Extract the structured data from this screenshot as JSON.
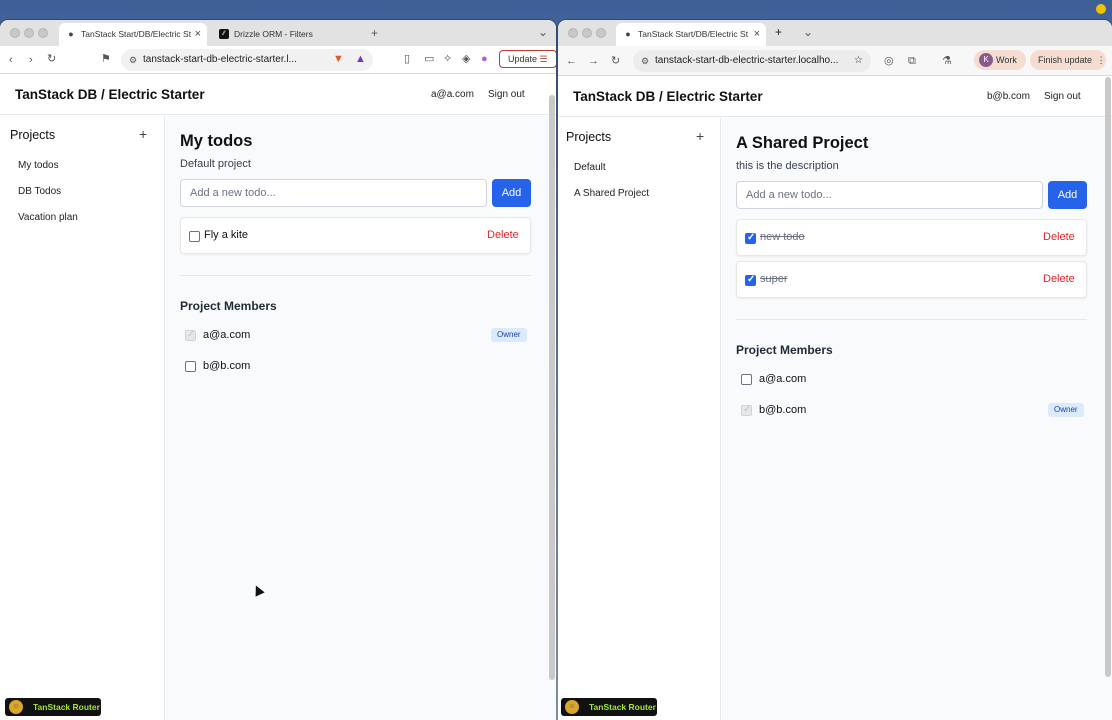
{
  "left": {
    "tabs": [
      {
        "title": "TanStack Start/DB/Electric St",
        "icon": "globe-icon",
        "active": true
      },
      {
        "title": "Drizzle ORM - Filters",
        "icon": "drizzle-icon",
        "active": false
      }
    ],
    "new_tab": "+",
    "tab_menu": "⌄",
    "url": "tanstack-start-db-electric-starter.l...",
    "update_label": "Update",
    "app_title": "TanStack DB / Electric Starter",
    "user_email": "a@a.com",
    "sign_out": "Sign out",
    "sidebar": {
      "title": "Projects",
      "add": "+",
      "items": [
        "My todos",
        "DB Todos",
        "Vacation plan"
      ]
    },
    "project": {
      "title": "My todos",
      "description": "Default project",
      "input_placeholder": "Add a new todo...",
      "add_label": "Add",
      "todos": [
        {
          "text": "Fly a kite",
          "done": false,
          "delete": "Delete"
        }
      ],
      "members_title": "Project Members",
      "members": [
        {
          "email": "a@a.com",
          "checked": true,
          "disabled": true,
          "badge": "Owner"
        },
        {
          "email": "b@b.com",
          "checked": false,
          "disabled": false,
          "badge": ""
        }
      ]
    },
    "devtools_label": "TanStack Router"
  },
  "right": {
    "tabs": [
      {
        "title": "TanStack Start/DB/Electric St",
        "icon": "globe-icon",
        "active": true
      }
    ],
    "new_tab": "+",
    "tab_menu": "⌄",
    "url": "tanstack-start-db-electric-starter.localho...",
    "profile_initial": "K",
    "profile_label": "Work",
    "finish_update": "Finish update",
    "app_title": "TanStack DB / Electric Starter",
    "user_email": "b@b.com",
    "sign_out": "Sign out",
    "sidebar": {
      "title": "Projects",
      "add": "+",
      "items": [
        "Default",
        "A Shared Project"
      ]
    },
    "project": {
      "title": "A Shared Project",
      "description": "this is the description",
      "input_placeholder": "Add a new todo...",
      "add_label": "Add",
      "todos": [
        {
          "text": "new todo",
          "done": true,
          "delete": "Delete"
        },
        {
          "text": "super",
          "done": true,
          "delete": "Delete"
        }
      ],
      "members_title": "Project Members",
      "members": [
        {
          "email": "a@a.com",
          "checked": false,
          "disabled": false,
          "badge": ""
        },
        {
          "email": "b@b.com",
          "checked": true,
          "disabled": true,
          "badge": "Owner"
        }
      ]
    },
    "devtools_label": "TanStack Router"
  },
  "colors": {
    "primary": "#2563eb",
    "danger": "#dc2626",
    "owner_badge_bg": "#dbeafe",
    "owner_badge_text": "#1e40af"
  }
}
